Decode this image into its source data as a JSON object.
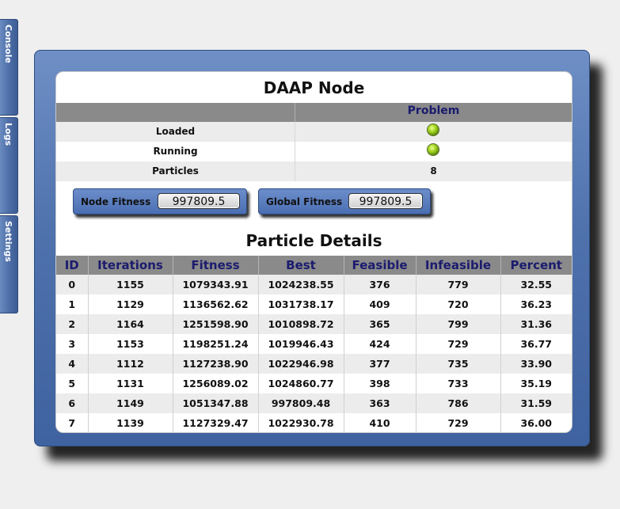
{
  "side_tabs": [
    {
      "label": "Console"
    },
    {
      "label": "Logs"
    },
    {
      "label": "Settings"
    }
  ],
  "node": {
    "title": "DAAP Node",
    "status_header": "Problem",
    "status_rows": [
      {
        "label": "Loaded",
        "indicator": "green-led"
      },
      {
        "label": "Running",
        "indicator": "green-led"
      },
      {
        "label": "Particles",
        "value": "8"
      }
    ],
    "node_fitness": {
      "label": "Node Fitness",
      "value": "997809.5"
    },
    "global_fitness": {
      "label": "Global Fitness",
      "value": "997809.5"
    }
  },
  "particles": {
    "title": "Particle Details",
    "columns": [
      "ID",
      "Iterations",
      "Fitness",
      "Best",
      "Feasible",
      "Infeasible",
      "Percent"
    ],
    "rows": [
      [
        "0",
        "1155",
        "1079343.91",
        "1024238.55",
        "376",
        "779",
        "32.55"
      ],
      [
        "1",
        "1129",
        "1136562.62",
        "1031738.17",
        "409",
        "720",
        "36.23"
      ],
      [
        "2",
        "1164",
        "1251598.90",
        "1010898.72",
        "365",
        "799",
        "31.36"
      ],
      [
        "3",
        "1153",
        "1198251.24",
        "1019946.43",
        "424",
        "729",
        "36.77"
      ],
      [
        "4",
        "1112",
        "1127238.90",
        "1022946.98",
        "377",
        "735",
        "33.90"
      ],
      [
        "5",
        "1131",
        "1256089.02",
        "1024860.77",
        "398",
        "733",
        "35.19"
      ],
      [
        "6",
        "1149",
        "1051347.88",
        "997809.48",
        "363",
        "786",
        "31.59"
      ],
      [
        "7",
        "1139",
        "1127329.47",
        "1022930.78",
        "410",
        "729",
        "36.00"
      ]
    ]
  },
  "colors": {
    "accent_blue": "#4f72ad",
    "header_text": "#1b1b6e",
    "header_bg": "#8a8a8a",
    "led_green": "#9ed11e"
  }
}
